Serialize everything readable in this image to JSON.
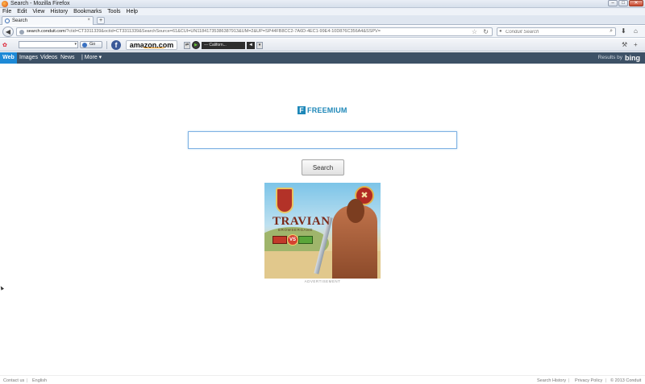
{
  "window": {
    "title": "Search - Mozilla Firefox",
    "minimize": "–",
    "maximize": "□",
    "close": "✕"
  },
  "menu": [
    "File",
    "Edit",
    "View",
    "History",
    "Bookmarks",
    "Tools",
    "Help"
  ],
  "tabs": {
    "active_label": "Search",
    "close": "×",
    "new_tab": "+"
  },
  "navbar": {
    "back": "◀",
    "url_host": "search.conduit.com",
    "url_rest": "/?ctid=CT3311339&octid=CT3311339&SearchSource=61&CUI=UN11841735386387913&UM=2&UP=SP44FB8CC2-7A6D-4EC1-99E4-10D876C356A4&SSPV=",
    "star": "☆",
    "reload": "↻",
    "search_engine_glyph": "●",
    "search_placeholder": "Conduit Search",
    "search_go": "⌕",
    "download": "⬇",
    "home": "⌂"
  },
  "toolbar": {
    "logo": "✿",
    "dropdown": "▾",
    "go_label": "Go",
    "facebook": "f",
    "amazon": "amazon.com",
    "radio_prev": "⇄",
    "radio_play": "▶",
    "radio_station": "--- Californ...",
    "radio_volume": "◄",
    "radio_more": "▾",
    "wrench": "⚒",
    "plus": "+"
  },
  "search_nav": {
    "web": "Web",
    "images": "Images",
    "videos": "Videos",
    "news": "News",
    "more": "| More ▾",
    "results_by": "Results by",
    "bing": "bing"
  },
  "brand": {
    "letter": "F",
    "name": "FREEMIUM"
  },
  "main": {
    "search_value": "",
    "search_button": "Search"
  },
  "ad": {
    "game_title": "TRAVIAN",
    "game_subtitle": "BROWSERGAME",
    "vs": "VS",
    "medal_glyph": "✖",
    "label": "ADVERTISEMENT"
  },
  "footer": {
    "contact": "Contact us",
    "language": "English",
    "history": "Search History",
    "privacy": "Privacy Policy",
    "copyright": "© 2013 Conduit",
    "divider": "|"
  },
  "colors": {
    "brand_blue": "#1d87b8",
    "nav_strip": "#3d5166",
    "web_tab": "#1d89d6"
  }
}
